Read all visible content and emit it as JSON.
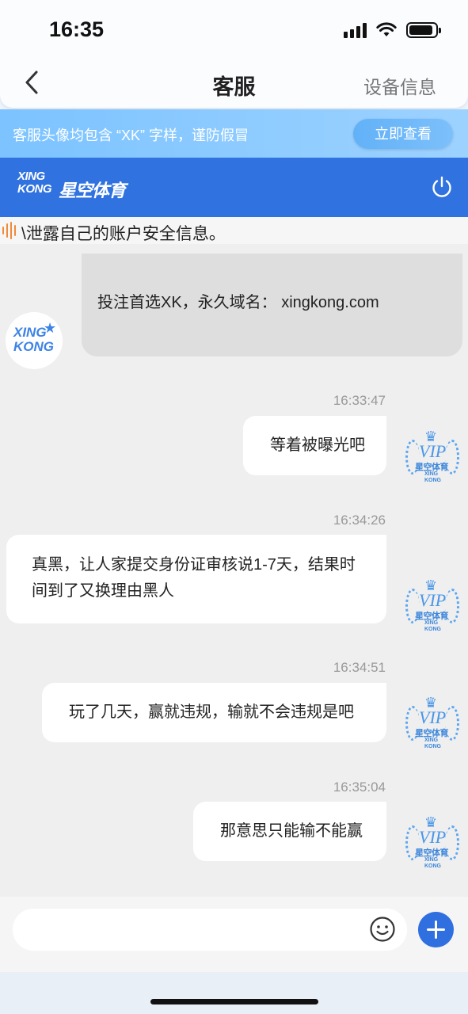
{
  "status_bar": {
    "time": "16:35",
    "icons": [
      "cellular-signal-icon",
      "wifi-icon",
      "battery-icon"
    ],
    "battery_level": 0.9
  },
  "nav": {
    "back_icon": "chevron-left-icon",
    "title": "客服",
    "right_label": "设备信息"
  },
  "notice": {
    "text": "客服头像均包含 “XK” 字样，谨防假冒",
    "button_label": "立即查看"
  },
  "brand": {
    "logo_text_top": "XING",
    "logo_text_bottom": "KONG",
    "logo_cn": "星空体育",
    "power_icon": "power-icon",
    "color": "#2f72e0"
  },
  "scrolled_message": {
    "text": "\\泄露自己的账户安全信息。"
  },
  "system_message": {
    "text": "投注首选XK，永久域名： xingkong.com",
    "avatar_top": "XING",
    "avatar_bottom": "KONG"
  },
  "messages": [
    {
      "timestamp": "16:33:47",
      "text": "等着被曝光吧",
      "side": "right"
    },
    {
      "timestamp": "16:34:26",
      "text": "真黑，让人家提交身份证审核说1-7天，结果时间到了又换理由黑人",
      "side": "right"
    },
    {
      "timestamp": "16:34:51",
      "text": "玩了几天，赢就违规，输就不会违规是吧",
      "side": "right"
    },
    {
      "timestamp": "16:35:04",
      "text": "那意思只能输不能赢",
      "side": "right"
    }
  ],
  "vip_avatar": {
    "label": "VIP",
    "cn": "星空体育",
    "en_top": "XING",
    "en_bottom": "KONG"
  },
  "input": {
    "placeholder": "",
    "emoji_icon": "emoji-icon",
    "plus_icon": "plus-icon"
  }
}
